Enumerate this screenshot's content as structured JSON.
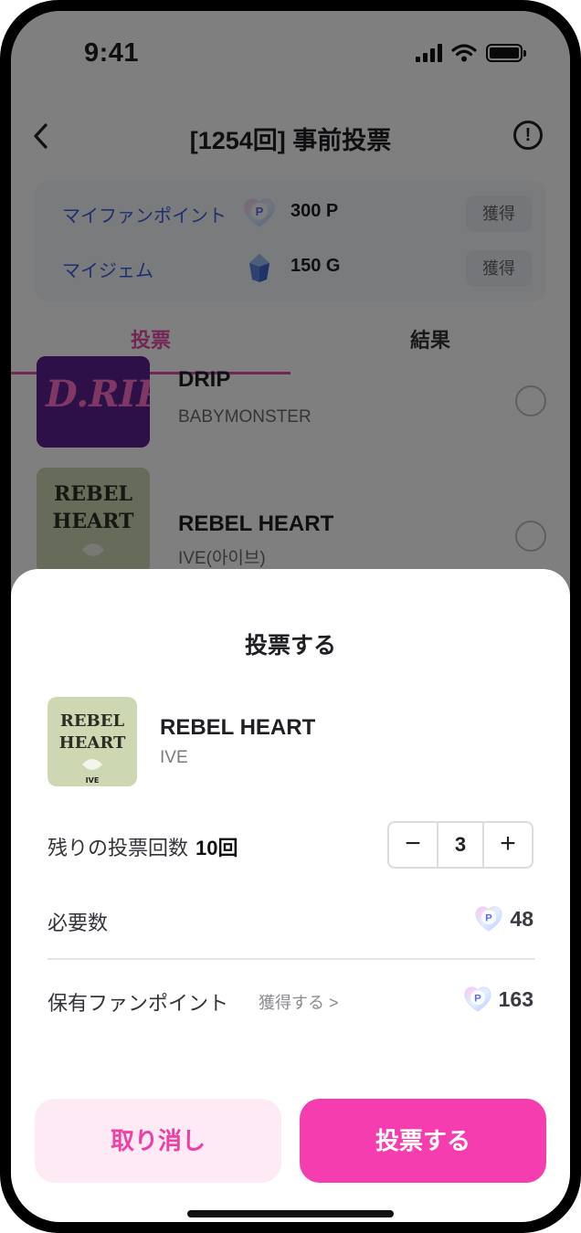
{
  "status_bar": {
    "time": "9:41"
  },
  "header": {
    "title": "[1254回] 事前投票"
  },
  "points": [
    {
      "label": "マイファンポイント",
      "icon": "fan-point-p-icon",
      "value": "300 P",
      "action": "獲得"
    },
    {
      "label": "マイジェム",
      "icon": "gem-icon",
      "value": "150 G",
      "action": "獲得"
    }
  ],
  "tabs": [
    {
      "label": "投票"
    },
    {
      "label": "結果"
    }
  ],
  "songs": [
    {
      "title": "DRIP",
      "artist": "BABYMONSTER"
    },
    {
      "title": "REBEL HEART",
      "artist": "IVE(아이브)"
    }
  ],
  "sheet": {
    "title": "投票する",
    "selected": {
      "title": "REBEL HEART",
      "artist": "IVE"
    },
    "remaining_label": "残りの投票回数",
    "remaining_value": "10回",
    "stepper": {
      "minus": "−",
      "value": "3",
      "plus": "+"
    },
    "required_label": "必要数",
    "required_value": "48",
    "owned_label": "保有ファンポイント",
    "get_link": "獲得する >",
    "owned_value": "163",
    "cancel_label": "取り消し",
    "vote_label": "投票する"
  },
  "colors": {
    "accent": "#f53db0",
    "accent_light": "#fdeaf5",
    "link_blue": "#3d5fe0"
  }
}
